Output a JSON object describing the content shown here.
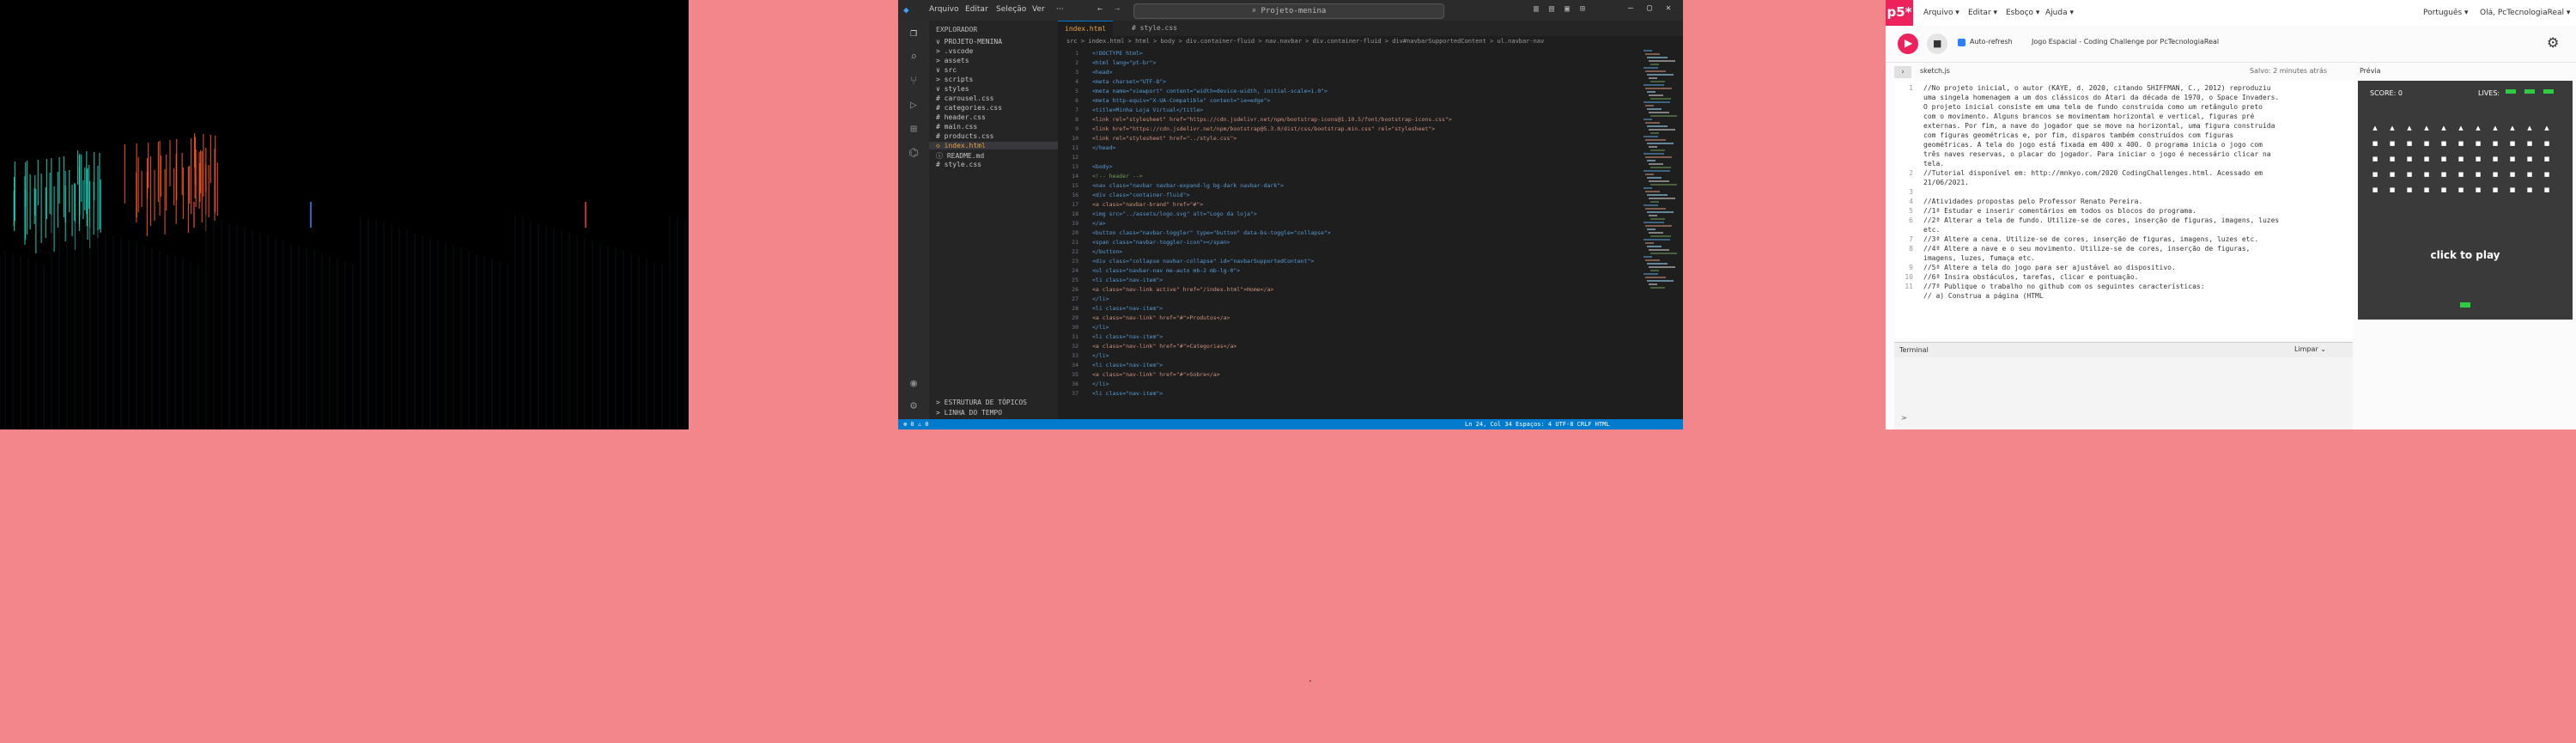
{
  "vscode": {
    "menus": [
      "Arquivo",
      "Editar",
      "Seleção",
      "Ver",
      "···"
    ],
    "search_placeholder": "Projeto-menina",
    "explorer_title": "EXPLORADOR",
    "tree": [
      "∨ PROJETO-MENINA",
      " > .vscode",
      " > assets",
      " ∨ src",
      "   > scripts",
      "   ∨ styles",
      "     # carousel.css",
      "     # categories.css",
      "     # header.css",
      "     # main.css",
      "     # products.css",
      " ◇ index.html",
      " ⓘ README.md",
      " # style.css"
    ],
    "outline_label": "> ESTRUTURA DE TÓPICOS",
    "timeline_label": "> LINHA DO TEMPO",
    "tabs": [
      "index.html",
      "# style.css"
    ],
    "breadcrumb": "src > index.html > html > body > div.container-fluid > nav.navbar > div.container-fluid > div#navbarSupportedContent > ul.navbar-nav",
    "code_lines": [
      "<!DOCTYPE html>",
      "<html lang=\"pt-br\">",
      "<head>",
      "  <meta charset=\"UTF-8\">",
      "  <meta name=\"viewport\" content=\"width=device-width, initial-scale=1.0\">",
      "  <meta http-equiv=\"X-UA-Compatible\" content=\"ie=edge\">",
      "  <title>Minha Loja Virtual</title>",
      "  <link rel=\"stylesheet\" href=\"https://cdn.jsdelivr.net/npm/bootstrap-icons@1.10.5/font/bootstrap-icons.css\">",
      "  <link href=\"https://cdn.jsdelivr.net/npm/bootstrap@5.3.0/dist/css/bootstrap.min.css\" rel=\"stylesheet\">",
      "  <link rel=\"stylesheet\" href=\"../style.css\">",
      "</head>",
      "",
      "<body>",
      "  <!-- header -->",
      "  <nav class=\"navbar navbar-expand-lg bg-dark navbar-dark\">",
      "    <div class=\"container-fluid\">",
      "      <a class=\"navbar-brand\" href=\"#\">",
      "        <img src=\"../assets/logo.svg\" alt=\"Logo da loja\">",
      "      </a>",
      "      <button class=\"navbar-toggler\" type=\"button\" data-bs-toggle=\"collapse\">",
      "        <span class=\"navbar-toggler-icon\"></span>",
      "      </button>",
      "      <div class=\"collapse navbar-collapse\" id=\"navbarSupportedContent\">",
      "        <ul class=\"navbar-nav me-auto mb-2 mb-lg-0\">",
      "          <li class=\"nav-item\">",
      "            <a class=\"nav-link active\" href=\"/index.html\">Home</a>",
      "          </li>",
      "          <li class=\"nav-item\">",
      "            <a class=\"nav-link\" href=\"#\">Produtos</a>",
      "          </li>",
      "          <li class=\"nav-item\">",
      "            <a class=\"nav-link\" href=\"#\">Categorias</a>",
      "          </li>",
      "          <li class=\"nav-item\">",
      "            <a class=\"nav-link\" href=\"#\">Sobre</a>",
      "          </li>",
      "          <li class=\"nav-item\">"
    ],
    "status_left": "⊗ 0 ⚠ 0",
    "status_right": "Ln 24, Col 34   Espaços: 4   UTF-8   CRLF   HTML"
  },
  "p5": {
    "logo": "p5*",
    "menus": [
      "Arquivo ▾",
      "Editar ▾",
      "Esboço ▾",
      "Ajuda ▾"
    ],
    "lang": "Português ▾",
    "user": "Olá, PcTecnologiaReal ▾",
    "auto_refresh": "Auto-refresh",
    "sketch_name": "Jogo Espacial - Coding Challenge por PcTecnologiaReal",
    "file_label": "sketch.js",
    "saved_label": "Salvo: 2 minutes atrás",
    "preview_label": "Prévia",
    "code_lines": [
      {
        "n": "1",
        "t": "//No projeto inicial, o autor (KAYE, d. 2020, citando SHIFFMAN, C., 2012) reproduziu"
      },
      {
        "n": "",
        "t": "uma singela homenagem a um dos clássicos do Atari da década de 1970, o Space Invaders."
      },
      {
        "n": "",
        "t": "O projeto inicial consiste em uma tela de fundo construída como um retângulo preto"
      },
      {
        "n": "",
        "t": "com o movimento. Alguns brancos se movimentam horizontal e vertical, figuras pré"
      },
      {
        "n": "",
        "t": "externas. Por fim, a nave do jogador que se move na horizontal, uma figura construída"
      },
      {
        "n": "",
        "t": "com figuras geométricas e, por fim, disparos também construídos com figuras"
      },
      {
        "n": "",
        "t": "geométricas. A tela do jogo está fixada em 400 x 400. O programa inicia o jogo com"
      },
      {
        "n": "",
        "t": "três naves reservas, o placar do jogador. Para iniciar o jogo é necessário clicar na"
      },
      {
        "n": "",
        "t": "tela."
      },
      {
        "n": "2",
        "t": "//Tutorial disponível em: http://mnkyo.com/2020 CodingChallenges.html. Acessado em"
      },
      {
        "n": "",
        "t": "21/06/2021."
      },
      {
        "n": "3",
        "t": ""
      },
      {
        "n": "4",
        "t": "//Atividades propostas pelo Professor Renato Pereira."
      },
      {
        "n": "5",
        "t": "//1ª Estudar e inserir comentários em todos os blocos do programa."
      },
      {
        "n": "6",
        "t": "//2ª Alterar a tela de fundo. Utilize-se de cores, inserção de figuras, imagens, luzes"
      },
      {
        "n": "",
        "t": "etc."
      },
      {
        "n": "7",
        "t": "//3ª Altere a cena. Utilize-se de cores, inserção de figuras, imagens, luzes etc."
      },
      {
        "n": "8",
        "t": "//4ª Altere a nave e o seu movimento. Utilize-se de cores, inserção de figuras,"
      },
      {
        "n": "",
        "t": "imagens, luzes, fumaça etc."
      },
      {
        "n": "9",
        "t": "//5ª Altere a tela do jogo para ser ajustável ao dispositivo."
      },
      {
        "n": "10",
        "t": "//6ª Insira obstáculos, tarefas, clicar e pontuação."
      },
      {
        "n": "11",
        "t": "//7ª Publique o trabalho no github com os seguintes características:"
      },
      {
        "n": "",
        "t": "//  a) Construa a página (HTML"
      }
    ],
    "console_label": "Terminal",
    "clear_label": "Limpar ⌄",
    "console_prompt": ">",
    "game": {
      "score": "SCORE: 0",
      "lives_label": "LIVES:",
      "prompt": "click to play"
    }
  },
  "taskbar_dot": "·"
}
